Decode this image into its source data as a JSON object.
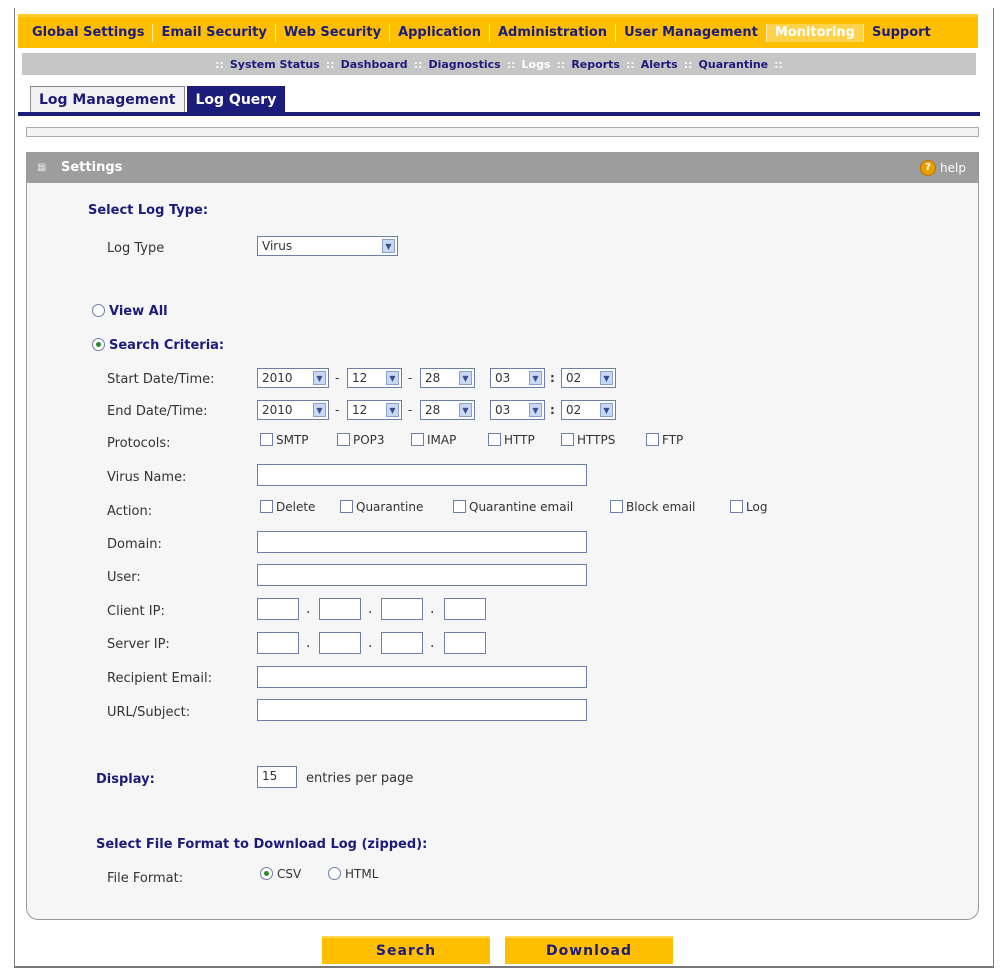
{
  "nav": {
    "items": [
      "Global Settings",
      "Email Security",
      "Web Security",
      "Application",
      "Administration",
      "User Management",
      "Monitoring",
      "Support"
    ],
    "active": "Monitoring"
  },
  "subnav": {
    "items": [
      "System Status",
      "Dashboard",
      "Diagnostics",
      "Logs",
      "Reports",
      "Alerts",
      "Quarantine"
    ],
    "active": "Logs"
  },
  "tabs": [
    "Log Management",
    "Log Query"
  ],
  "panel": {
    "title": "Settings",
    "help": "help"
  },
  "form": {
    "select_log_type": "Select Log Type:",
    "log_type_label": "Log Type",
    "log_type_value": "Virus",
    "view_all": "View All",
    "search_criteria": "Search Criteria:",
    "start_label": "Start Date/Time:",
    "end_label": "End Date/Time:",
    "start": {
      "year": "2010",
      "month": "12",
      "day": "28",
      "hour": "03",
      "minute": "02"
    },
    "end": {
      "year": "2010",
      "month": "12",
      "day": "28",
      "hour": "03",
      "minute": "02"
    },
    "date_sep": "-",
    "time_sep": ":",
    "protocols_label": "Protocols:",
    "protocols": [
      "SMTP",
      "POP3",
      "IMAP",
      "HTTP",
      "HTTPS",
      "FTP"
    ],
    "virus_name_label": "Virus Name:",
    "action_label": "Action:",
    "actions": [
      "Delete",
      "Quarantine",
      "Quarantine email",
      "Block email",
      "Log"
    ],
    "domain_label": "Domain:",
    "user_label": "User:",
    "client_ip_label": "Client IP:",
    "server_ip_label": "Server IP:",
    "ip_dot": ".",
    "recipient_label": "Recipient Email:",
    "url_label": "URL/Subject:",
    "display_label": "Display:",
    "display_value": "15",
    "display_suffix": "entries per page",
    "file_format_header": "Select File Format to Download Log (zipped):",
    "file_format_label": "File Format:",
    "format_csv": "CSV",
    "format_html": "HTML"
  },
  "buttons": {
    "search": "Search",
    "download": "Download"
  }
}
